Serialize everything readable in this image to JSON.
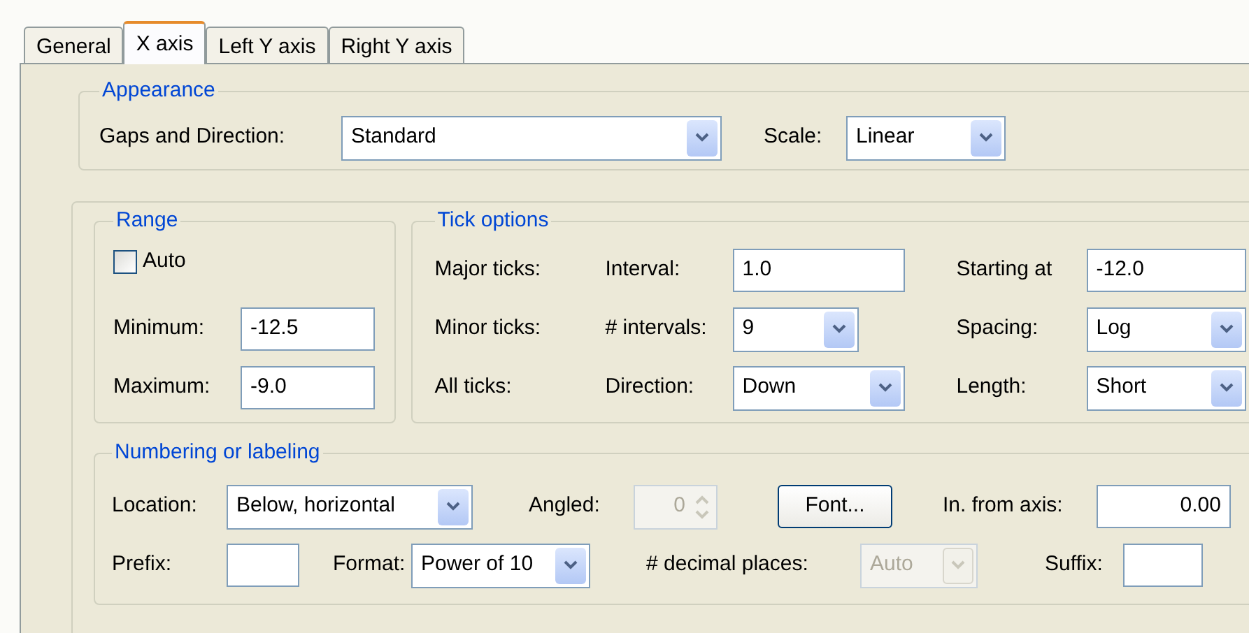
{
  "tabs": [
    {
      "label": "General",
      "selected": false
    },
    {
      "label": "X axis",
      "selected": true
    },
    {
      "label": "Left Y axis",
      "selected": false
    },
    {
      "label": "Right Y axis",
      "selected": false
    }
  ],
  "appearance": {
    "title": "Appearance",
    "gaps_label": "Gaps and Direction:",
    "gaps": {
      "value": "Standard"
    },
    "scale_label": "Scale:",
    "scale": {
      "value": "Linear"
    }
  },
  "range": {
    "title": "Range",
    "auto": {
      "label": "Auto",
      "checked": false
    },
    "fields": [
      {
        "label": "Minimum:",
        "value": "-12.5"
      },
      {
        "label": "Maximum:",
        "value": "-9.0"
      }
    ]
  },
  "tick_options": {
    "title": "Tick options",
    "rows": [
      {
        "label": "Major ticks:",
        "field_label": "Interval:",
        "field": {
          "kind": "text",
          "value": "1.0"
        },
        "right_label": "Starting at",
        "right": {
          "kind": "text",
          "value": "-12.0"
        }
      },
      {
        "label": "Minor ticks:",
        "field_label": "# intervals:",
        "field": {
          "kind": "combo",
          "value": "9"
        },
        "right_label": "Spacing:",
        "right": {
          "kind": "combo",
          "value": "Log"
        }
      },
      {
        "label": "All ticks:",
        "field_label": "Direction:",
        "field": {
          "kind": "combo",
          "value": "Down"
        },
        "right_label": "Length:",
        "right": {
          "kind": "combo",
          "value": "Short"
        }
      }
    ]
  },
  "numbering": {
    "title": "Numbering or labeling",
    "location_label": "Location:",
    "location": {
      "value": "Below, horizontal"
    },
    "angled_label": "Angled:",
    "angled": {
      "value": "0",
      "disabled": true
    },
    "font_button": "Font...",
    "offset_label": "In. from axis:",
    "offset": {
      "value": "0.00"
    },
    "prefix_label": "Prefix:",
    "format_label": "Format:",
    "format": {
      "value": "Power of 10"
    },
    "decimals_label": "# decimal places:",
    "decimals": {
      "value": "Auto",
      "disabled": true
    },
    "suffix_label": "Suffix:"
  }
}
